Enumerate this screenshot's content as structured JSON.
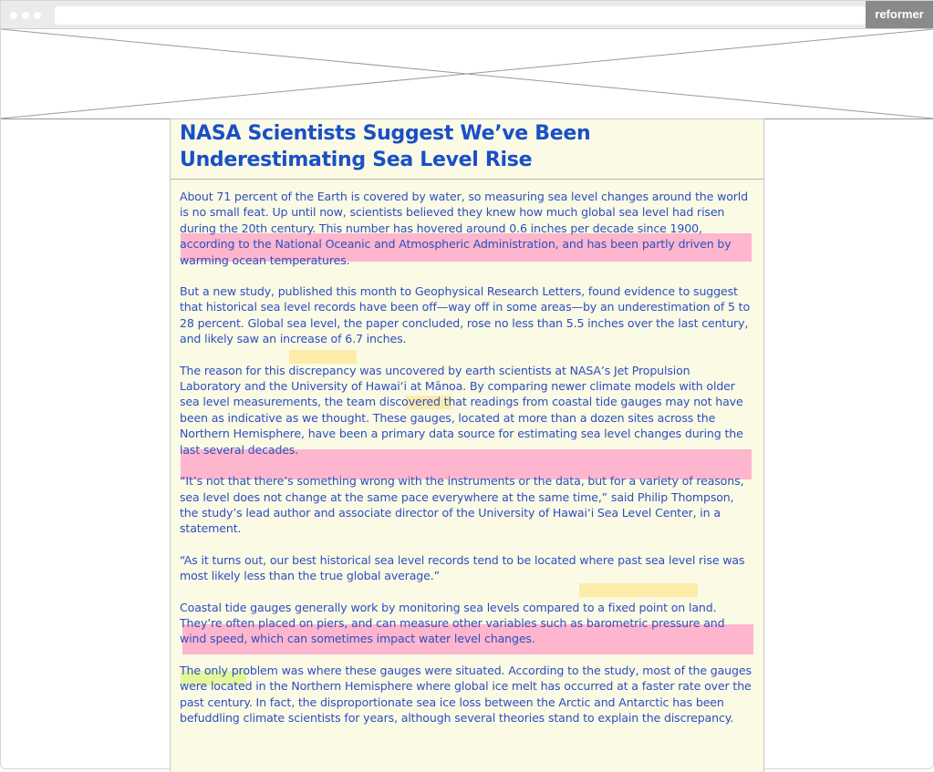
{
  "browser": {
    "brand": "reformer",
    "dots": [
      "window-dot-1",
      "window-dot-2",
      "window-dot-3"
    ]
  },
  "article": {
    "title": "NASA Scientists Suggest We’ve Been Underestimating Sea Level Rise",
    "paragraphs": [
      "About 71 percent of the Earth is covered by water, so measuring sea level changes around the world is no small feat. Up until now, scientists believed they knew how much global sea level had risen during the 20th century. This number has hovered around 0.6 inches per decade since 1900, according to the National Oceanic and Atmospheric Administration, and has been partly driven by warming ocean temperatures.",
      "But a new study, published this month to Geophysical Research Letters, found evidence to suggest that historical sea level records have been off—way off in some areas—by an underestimation of 5 to 28 percent. Global sea level, the paper concluded, rose no less than 5.5 inches over the last century, and likely saw an increase of 6.7 inches.",
      "The reason for this discrepancy was uncovered by earth scientists at NASA’s Jet Propulsion Laboratory and the University of Hawai‘i at Mānoa. By comparing newer climate models with older sea level measurements, the team discovered that readings from coastal tide gauges may not have been as indicative as we thought. These gauges, located at more than a dozen sites across the Northern Hemisphere, have been a primary data source for estimating sea level changes during the last several decades.",
      "“It’s not that there’s something wrong with the instruments or the data, but for a variety of reasons, sea level does not change at the same pace everywhere at the same time,” said Philip Thompson, the study’s lead author and associate director of the University of Hawai‘i Sea Level Center, in a statement.",
      "“As it turns out, our best historical sea level records tend to be located where past sea level rise was most likely less than the true global average.”",
      "Coastal tide gauges generally work by monitoring sea levels compared to a fixed point on land. They’re often placed on piers, and can measure other variables such as barometric pressure and wind speed, which can sometimes impact water level changes.",
      "The only problem was where these gauges were situated. According to the study, most of the gauges were located in the Northern Hemisphere where global ice melt has occurred at a faster rate over the past century. In fact, the disproportionate sea ice loss between the Arctic and Antarctic has been befuddling climate scientists for years, although several theories stand to explain the discrepancy."
    ]
  },
  "colors": {
    "title": "#1a4fc7",
    "text": "#2d4fc0",
    "article_bg": "#fafae5",
    "highlight_pink": "#ff8cbe",
    "highlight_yellow": "#ffe078",
    "highlight_green": "#dcf582"
  }
}
